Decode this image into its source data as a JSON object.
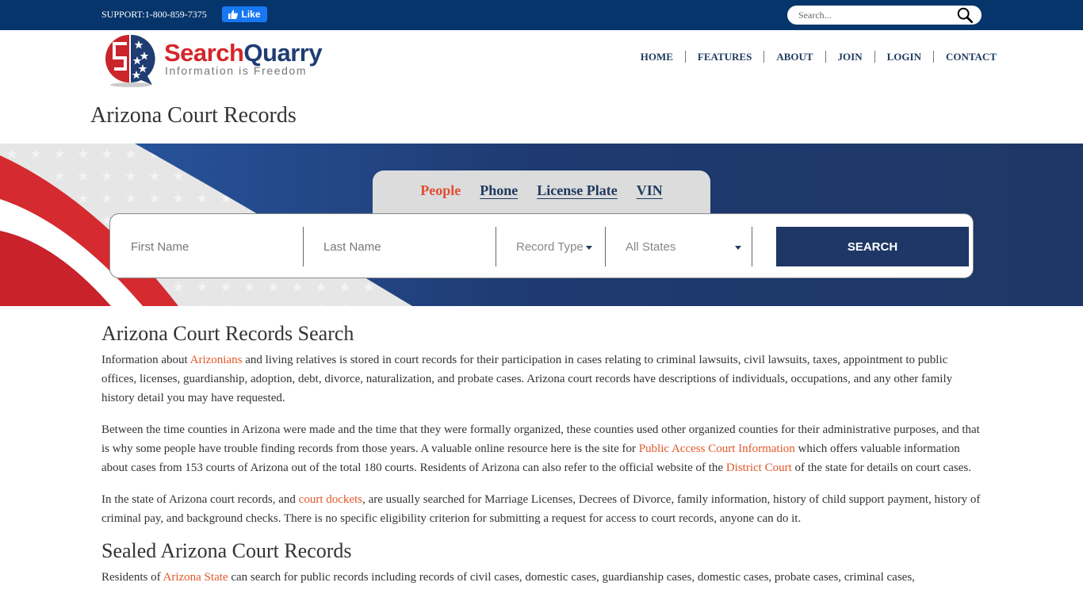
{
  "topbar": {
    "support_text": "SUPPORT:1-800-859-7375",
    "fb_like_label": "Like",
    "search_placeholder": "Search..."
  },
  "header": {
    "brand_part1": "Search",
    "brand_part2": "Quarry",
    "tagline": "Information is Freedom",
    "nav": [
      "HOME",
      "FEATURES",
      "ABOUT",
      "JOIN",
      "LOGIN",
      "CONTACT"
    ]
  },
  "page_title": "Arizona Court Records",
  "search": {
    "tabs": [
      {
        "label": "People",
        "active": true
      },
      {
        "label": "Phone",
        "active": false
      },
      {
        "label": "License Plate",
        "active": false
      },
      {
        "label": "VIN",
        "active": false
      }
    ],
    "first_name_placeholder": "First Name",
    "last_name_placeholder": "Last Name",
    "record_type_label": "Record Type",
    "state_label": "All States",
    "button_label": "SEARCH"
  },
  "colors": {
    "topbar": "#06356b",
    "navy": "#1e3766",
    "accent_link": "#e0582a",
    "active_tab": "#e04d32"
  },
  "content": {
    "h1": "Arizona Court Records Search",
    "p1": {
      "before": "Information about ",
      "link": "Arizonians",
      "after": " and living relatives is stored in court records for their participation in cases relating to criminal lawsuits, civil lawsuits, taxes, appointment to public offices, licenses, guardianship, adoption, debt, divorce, naturalization, and probate cases. Arizona court records have descriptions of individuals, occupations, and any other family history detail you may have requested."
    },
    "p2": {
      "t1": "Between the time counties in Arizona were made and the time that they were formally organized, these counties used other organized counties for their administrative purposes, and that is why some people have trouble finding records from those years. A valuable online resource here is the site for ",
      "link1": "Public Access Court Information",
      "t2": " which offers valuable information about cases from 153 courts of Arizona out of the total 180 courts. Residents of Arizona can also refer to the official website of the ",
      "link2": "District Court",
      "t3": " of the state for details on court cases."
    },
    "p3": {
      "before": "In the state of Arizona court records, and ",
      "link": "court dockets",
      "after": ", are usually searched for Marriage Licenses, Decrees of Divorce, family information, history of child support payment, history of criminal pay, and background checks. There is no specific eligibility criterion for submitting a request for access to court records, anyone can do it."
    },
    "h2": "Sealed Arizona Court Records",
    "p4": {
      "before": "Residents of ",
      "link": "Arizona State",
      "after": " can search for public records including records of civil cases, domestic cases, guardianship cases, domestic cases, probate cases, criminal cases,"
    }
  }
}
